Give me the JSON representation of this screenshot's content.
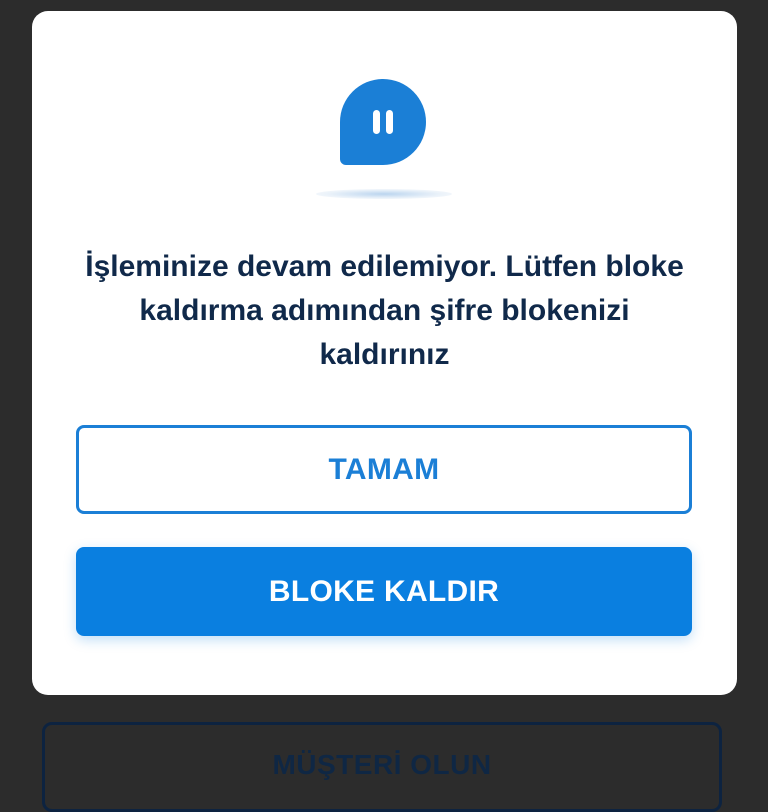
{
  "background": {
    "button_label": "MÜŞTERİ OLUN"
  },
  "dialog": {
    "icon": "pause-chat-bubble-icon",
    "message": "İşleminize devam edilemiyor. Lütfen bloke kaldırma adımından şifre blokenizi kaldırınız",
    "ok_label": "TAMAM",
    "unblock_label": "BLOKE KALDIR"
  },
  "colors": {
    "accent": "#1b7fd6",
    "primary_button": "#0a7fe0",
    "text": "#10294a",
    "overlay": "#2c2c2c"
  }
}
